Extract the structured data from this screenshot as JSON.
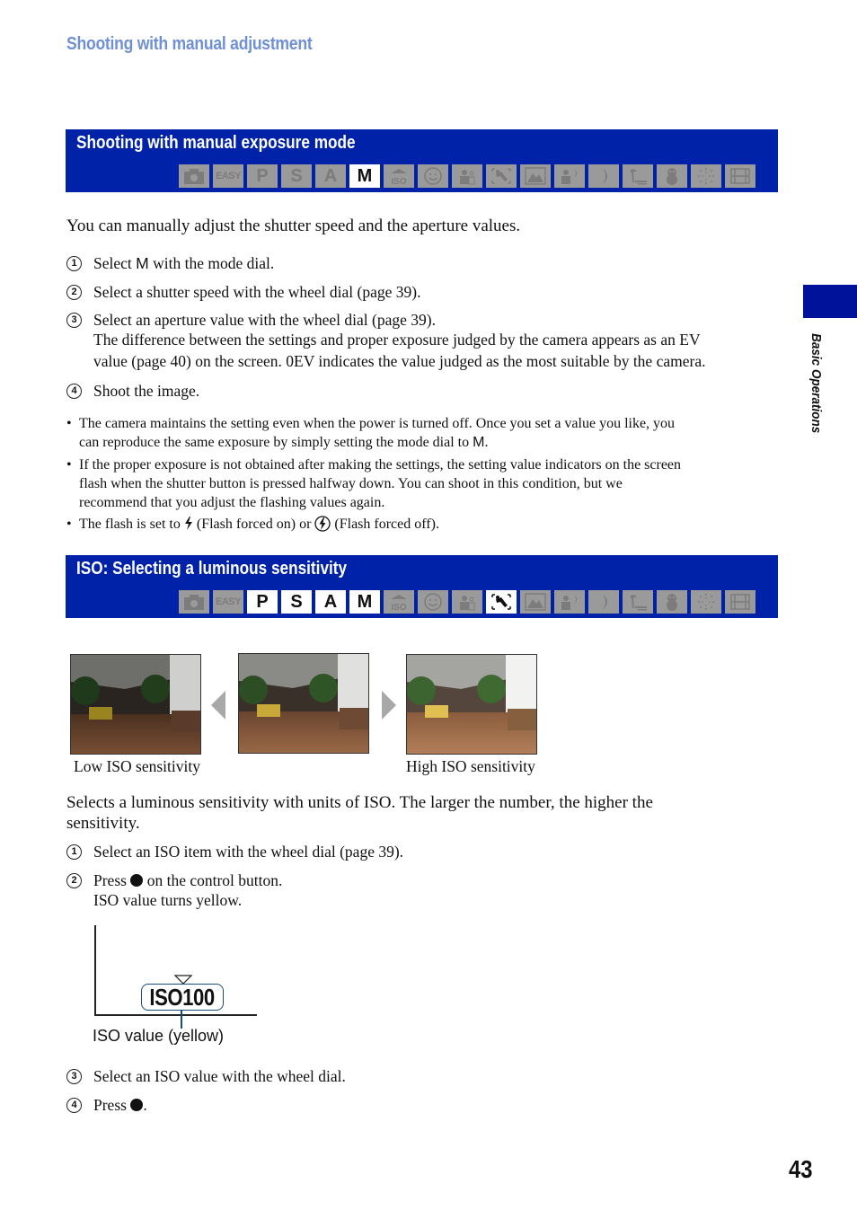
{
  "header": {
    "chapter_title": "Shooting with manual adjustment"
  },
  "sidebar": {
    "section_label": "Basic Operations",
    "accent_color": "#00129a"
  },
  "page_number": "43",
  "mode_icons": [
    {
      "name": "auto-camera-icon",
      "label": ""
    },
    {
      "name": "easy-mode-icon",
      "label": "EASY"
    },
    {
      "name": "program-mode-icon",
      "label": "P"
    },
    {
      "name": "shutter-priority-icon",
      "label": "S"
    },
    {
      "name": "aperture-priority-icon",
      "label": "A"
    },
    {
      "name": "manual-mode-icon",
      "label": "M"
    },
    {
      "name": "high-sensitivity-icon",
      "label": "ISO"
    },
    {
      "name": "smile-shutter-icon",
      "label": ""
    },
    {
      "name": "soft-snap-icon",
      "label": ""
    },
    {
      "name": "anti-blur-icon",
      "label": ""
    },
    {
      "name": "landscape-icon",
      "label": ""
    },
    {
      "name": "twilight-portrait-icon",
      "label": ""
    },
    {
      "name": "twilight-icon",
      "label": ""
    },
    {
      "name": "beach-icon",
      "label": ""
    },
    {
      "name": "snow-icon",
      "label": ""
    },
    {
      "name": "fireworks-icon",
      "label": ""
    },
    {
      "name": "movie-mode-icon",
      "label": ""
    }
  ],
  "section1": {
    "title": "Shooting with manual exposure mode",
    "active_modes": [
      "M"
    ],
    "intro": "You can manually adjust the shutter speed and the aperture values.",
    "steps": [
      {
        "num": "1",
        "pre": "Select ",
        "sym": "M",
        "post": " with the mode dial."
      },
      {
        "num": "2",
        "text": "Select a shutter speed with the wheel dial (page 39)."
      },
      {
        "num": "3",
        "text": "Select an aperture value with the wheel dial (page 39).",
        "extra1": "The difference between the settings and proper exposure judged by the camera appears as an EV",
        "extra2": "value (page 40) on the screen. 0EV indicates the value judged as the most suitable by the camera."
      },
      {
        "num": "4",
        "text": "Shoot the image."
      }
    ],
    "notes": [
      {
        "line1": "The camera maintains the setting even when the power is turned off. Once you set a value you like, you",
        "line2_pre": "can reproduce the same exposure by simply setting the mode dial to ",
        "line2_sym": "M",
        "line2_post": "."
      },
      {
        "line1": "If the proper exposure is not obtained after making the settings, the setting value indicators on the screen",
        "line2": "flash when the shutter button is pressed halfway down. You can shoot in this condition, but we",
        "line3": "recommend that you adjust the flashing values again."
      },
      {
        "pre": "The flash is set to ",
        "mid": " (Flash forced on) or ",
        "post": " (Flash forced off)."
      }
    ]
  },
  "section2": {
    "title": "ISO: Selecting a luminous sensitivity",
    "active_modes": [
      "P",
      "S",
      "A",
      "M",
      "anti-blur"
    ],
    "images": {
      "low_caption": "Low ISO sensitivity",
      "high_caption": "High ISO sensitivity"
    },
    "intro1": "Selects a luminous sensitivity with units of ISO. The larger the number, the higher the",
    "intro2": "sensitivity.",
    "steps": [
      {
        "num": "1",
        "text": "Select an ISO item with the wheel dial (page 39)."
      },
      {
        "num": "2",
        "pre": "Press ",
        "post": " on the control button.",
        "extra": "ISO value turns yellow."
      },
      {
        "num": "3",
        "text": "Select an ISO value with the wheel dial."
      },
      {
        "num": "4",
        "pre": "Press ",
        "post": "."
      }
    ],
    "diagram": {
      "iso_value": "ISO100",
      "callout": "ISO value (yellow)"
    }
  }
}
